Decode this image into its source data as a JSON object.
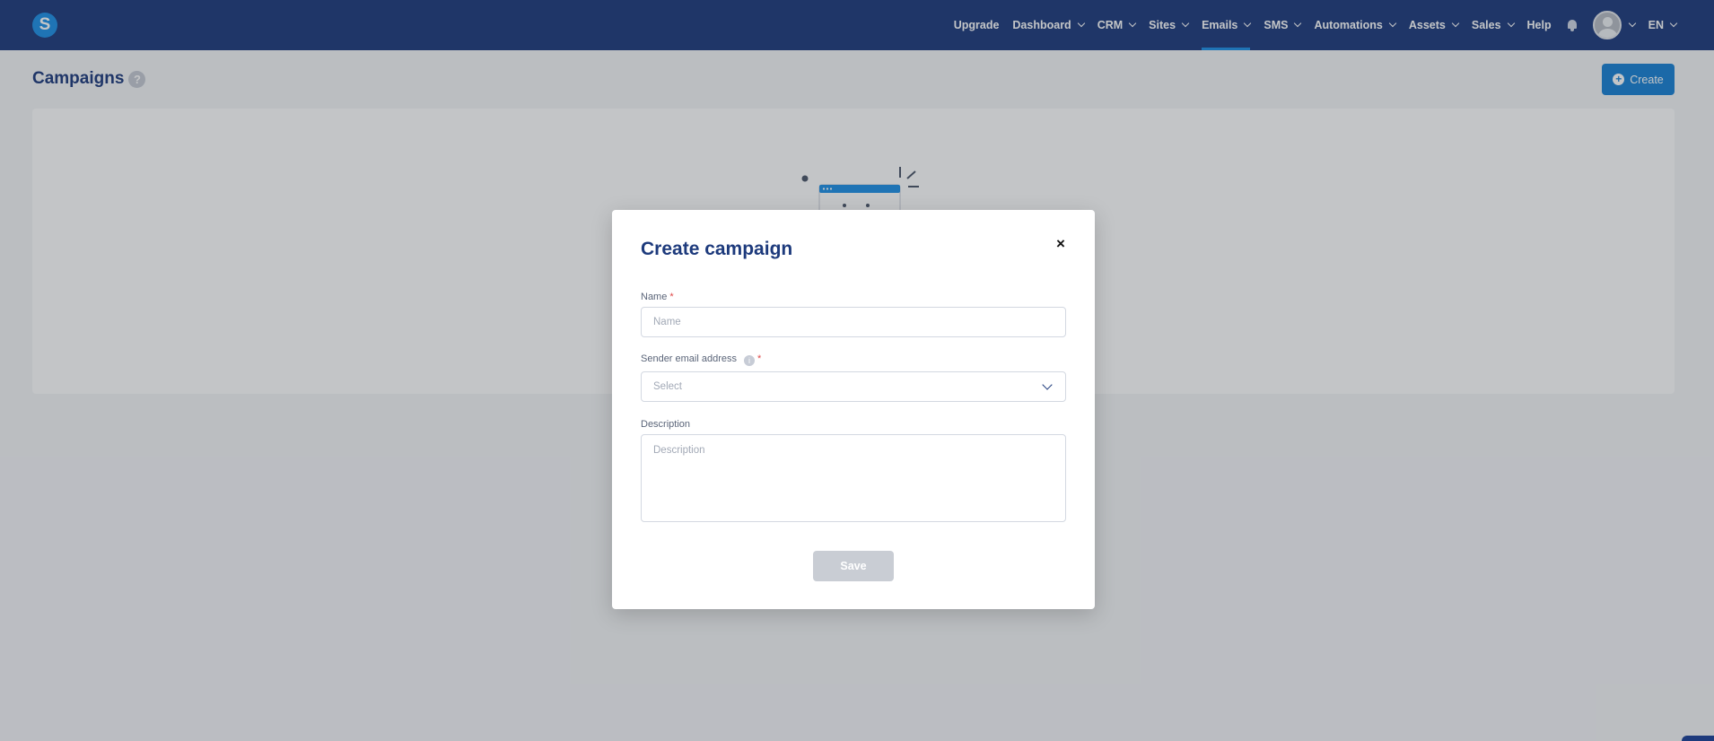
{
  "app": {
    "logo_letter": "S"
  },
  "nav": {
    "items": [
      {
        "label": "Upgrade",
        "dropdown": false
      },
      {
        "label": "Dashboard",
        "dropdown": true
      },
      {
        "label": "CRM",
        "dropdown": true
      },
      {
        "label": "Sites",
        "dropdown": true
      },
      {
        "label": "Emails",
        "dropdown": true,
        "active": true
      },
      {
        "label": "SMS",
        "dropdown": true
      },
      {
        "label": "Automations",
        "dropdown": true
      },
      {
        "label": "Assets",
        "dropdown": true
      },
      {
        "label": "Sales",
        "dropdown": true
      },
      {
        "label": "Help",
        "dropdown": false
      }
    ],
    "language": "EN"
  },
  "page": {
    "title": "Campaigns",
    "help_glyph": "?",
    "create_label": "Create"
  },
  "modal": {
    "title": "Create campaign",
    "close_glyph": "×",
    "name_label": "Name",
    "name_placeholder": "Name",
    "sender_label": "Sender email address",
    "sender_value": "Select",
    "description_label": "Description",
    "description_placeholder": "Description",
    "required_mark": "*",
    "save_label": "Save"
  },
  "colors": {
    "nav_bg": "#1d3a7c",
    "accent": "#1780d4",
    "title": "#1d3a7c",
    "required": "#e04848",
    "save_disabled": "#c9cdd4"
  },
  "icons": {
    "notifications": "bell-icon",
    "user": "avatar",
    "close": "close-icon",
    "create": "plus-circle-icon",
    "dropdown": "chevron-down-icon"
  }
}
